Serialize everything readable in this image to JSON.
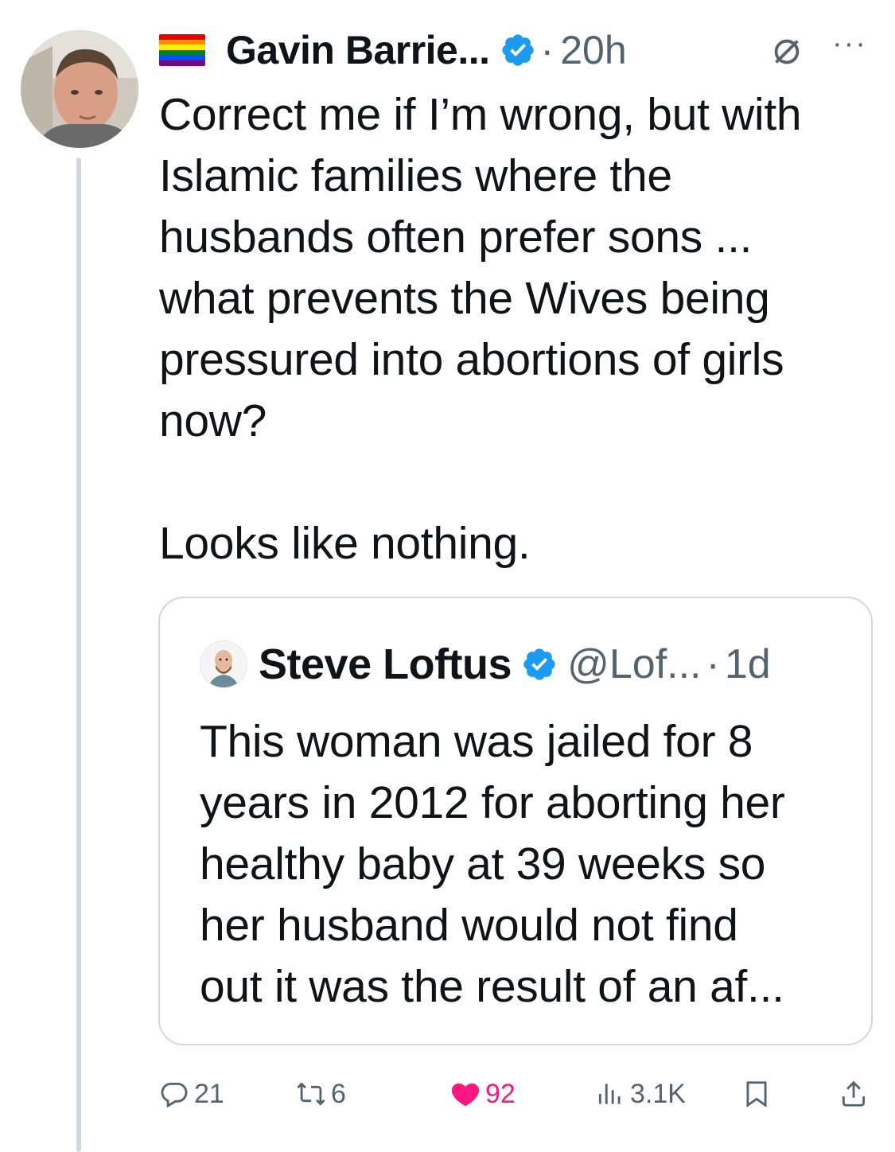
{
  "tweet": {
    "author_name": "Gavin Barrie...",
    "separator": "·",
    "time": "20h",
    "more_label": "···",
    "text": "Correct me if I’m wrong, but with\nIslamic families where the\nhusbands often prefer sons ...\nwhat prevents the Wives being\npressured into abortions of girls\nnow?\n\nLooks like nothing."
  },
  "quote": {
    "author_name": "Steve Loftus",
    "handle": "@Lof...",
    "separator": "·",
    "time": "1d",
    "text": "This woman was jailed for 8\nyears in 2012 for aborting her\nhealthy baby at 39 weeks so\nher husband would not find\nout it was the result of an af..."
  },
  "actions": {
    "replies": "21",
    "retweets": "6",
    "likes": "92",
    "views": "3.1K"
  },
  "icons": [
    "pride-flag-icon",
    "verified-badge-icon",
    "no-entry-icon",
    "more-icon",
    "reply-icon",
    "retweet-icon",
    "heart-icon",
    "views-icon",
    "bookmark-icon",
    "share-icon"
  ],
  "colors": {
    "verified": "#1d9bf0",
    "like": "#f91880",
    "muted": "#536471",
    "border": "#cfd9de",
    "text": "#0f1419"
  }
}
